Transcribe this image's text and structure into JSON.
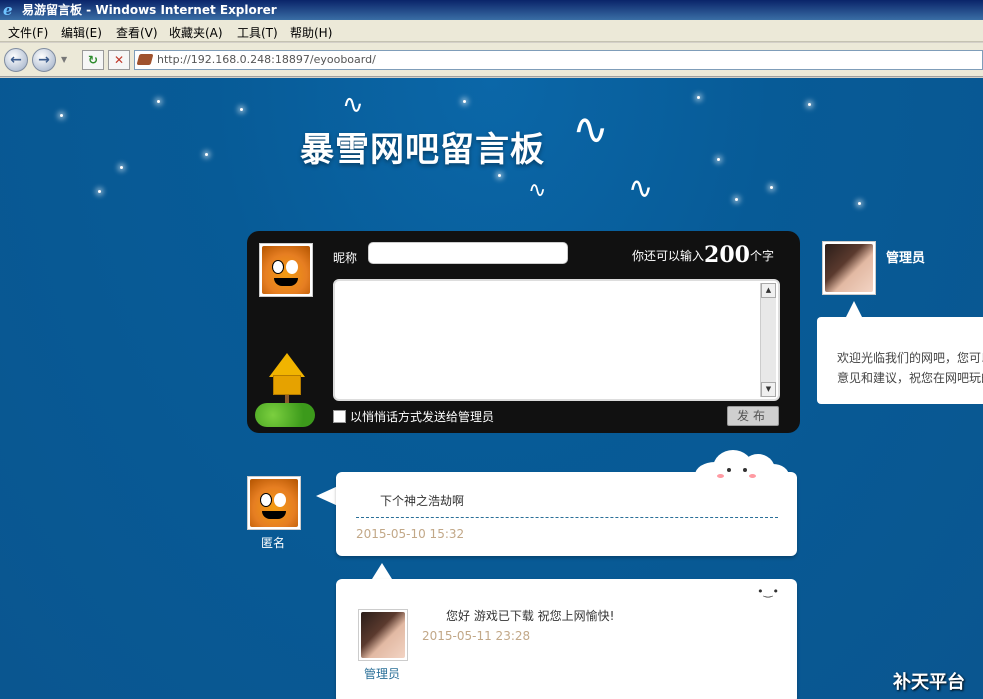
{
  "window": {
    "title": "易游留言板 - Windows Internet Explorer"
  },
  "menu": [
    {
      "label": "文件(F)"
    },
    {
      "label": "编辑(E)"
    },
    {
      "label": "查看(V)"
    },
    {
      "label": "收藏夹(A)"
    },
    {
      "label": "工具(T)"
    },
    {
      "label": "帮助(H)"
    }
  ],
  "address": {
    "url": "http://192.168.0.248:18897/eyooboard/"
  },
  "site": {
    "title": "暴雪网吧留言板"
  },
  "compose": {
    "nickname_label": "昵称",
    "nickname_value": "",
    "remaining_prefix": "你还可以输入",
    "remaining_count": "200",
    "remaining_suffix": "个字",
    "private_label": "以悄悄话方式发送给管理员",
    "publish_label": "发布"
  },
  "admin": {
    "name": "管理员",
    "welcome_line1": "欢迎光临我们的网吧，您可以",
    "welcome_line2": "意见和建议，祝您在网吧玩的"
  },
  "messages": [
    {
      "author": "匿名",
      "text": "下个神之浩劫啊",
      "time": "2015-05-10 15:32",
      "reply": {
        "author": "管理员",
        "text": "您好 游戏已下载 祝您上网愉快!",
        "time": "2015-05-11 23:28"
      }
    }
  ],
  "watermark": "补天平台",
  "icons": {
    "ie": "ie-logo-icon",
    "back": "back-arrow-icon",
    "forward": "forward-arrow-icon",
    "refresh": "refresh-icon",
    "stop": "stop-icon"
  }
}
